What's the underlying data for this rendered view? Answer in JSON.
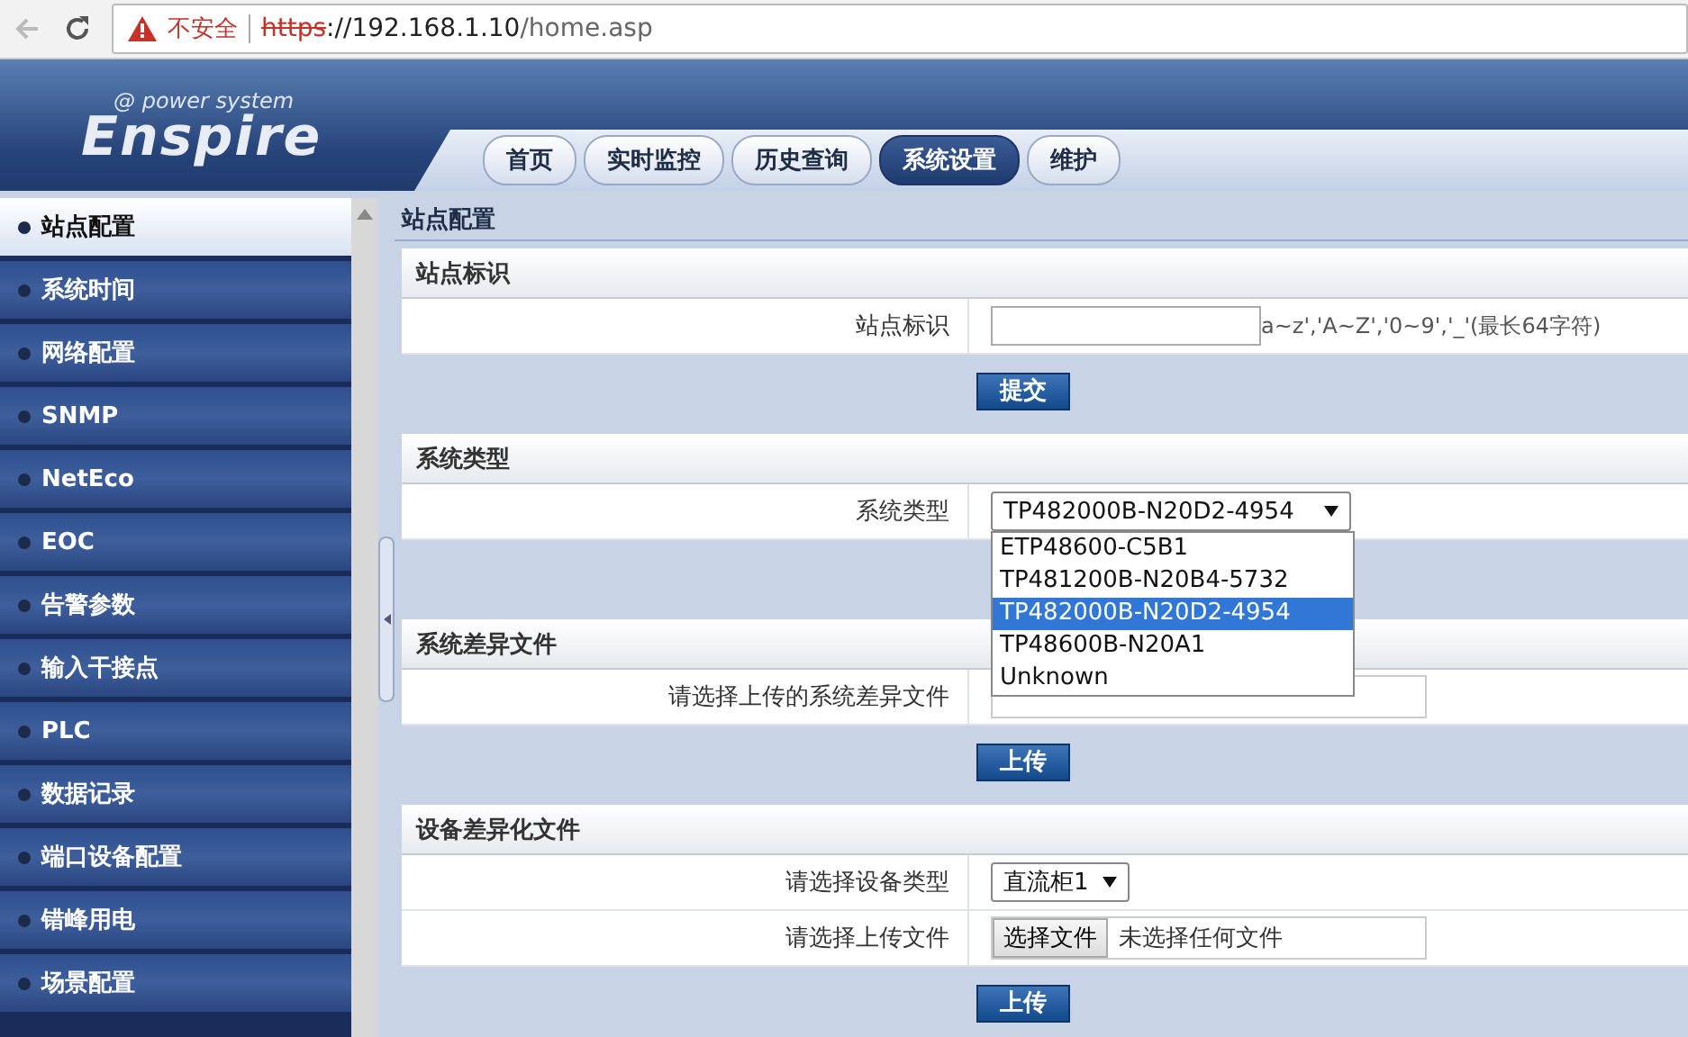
{
  "browser": {
    "security": "不安全",
    "url_scheme": "https",
    "url_host": "://192.168.1.10",
    "url_path": "/home.asp"
  },
  "logo": {
    "mark": "@",
    "tagline": "power system",
    "name": "Enspire"
  },
  "tabs": [
    {
      "label": "首页",
      "selected": false
    },
    {
      "label": "实时监控",
      "selected": false
    },
    {
      "label": "历史查询",
      "selected": false
    },
    {
      "label": "系统设置",
      "selected": true
    },
    {
      "label": "维护",
      "selected": false
    }
  ],
  "sidebar": {
    "items": [
      {
        "label": "站点配置",
        "selected": true
      },
      {
        "label": "系统时间",
        "selected": false
      },
      {
        "label": "网络配置",
        "selected": false
      },
      {
        "label": "SNMP",
        "selected": false
      },
      {
        "label": "NetEco",
        "selected": false
      },
      {
        "label": "EOC",
        "selected": false
      },
      {
        "label": "告警参数",
        "selected": false
      },
      {
        "label": "输入干接点",
        "selected": false
      },
      {
        "label": "PLC",
        "selected": false
      },
      {
        "label": "数据记录",
        "selected": false
      },
      {
        "label": "端口设备配置",
        "selected": false
      },
      {
        "label": "错峰用电",
        "selected": false
      },
      {
        "label": "场景配置",
        "selected": false
      }
    ]
  },
  "content": {
    "title": "站点配置",
    "sections": [
      {
        "title": "站点标识",
        "rows": [
          {
            "kind": "text",
            "label": "站点标识",
            "hint": "a~z','A~Z','0~9','_'(最长64字符)"
          }
        ],
        "button": "提交"
      },
      {
        "title": "系统类型",
        "rows": [
          {
            "kind": "select",
            "label": "系统类型",
            "value": "TP482000B-N20D2-4954",
            "expanded": true,
            "options": [
              {
                "label": "ETP48600-C5B1",
                "selected": false
              },
              {
                "label": "TP481200B-N20B4-5732",
                "selected": false
              },
              {
                "label": "TP482000B-N20D2-4954",
                "selected": true
              },
              {
                "label": "TP48600B-N20A1",
                "selected": false
              },
              {
                "label": "Unknown",
                "selected": false
              }
            ]
          }
        ]
      },
      {
        "title": "系统差异文件",
        "rows": [
          {
            "kind": "file",
            "label": "请选择上传的系统差异文件"
          }
        ],
        "button": "上传"
      },
      {
        "title": "设备差异化文件",
        "rows": [
          {
            "kind": "select",
            "label": "请选择设备类型",
            "value": "直流柜1",
            "expanded": false
          },
          {
            "kind": "file",
            "label": "请选择上传文件",
            "button": "选择文件",
            "status": "未选择任何文件"
          }
        ],
        "button": "上传"
      }
    ]
  }
}
